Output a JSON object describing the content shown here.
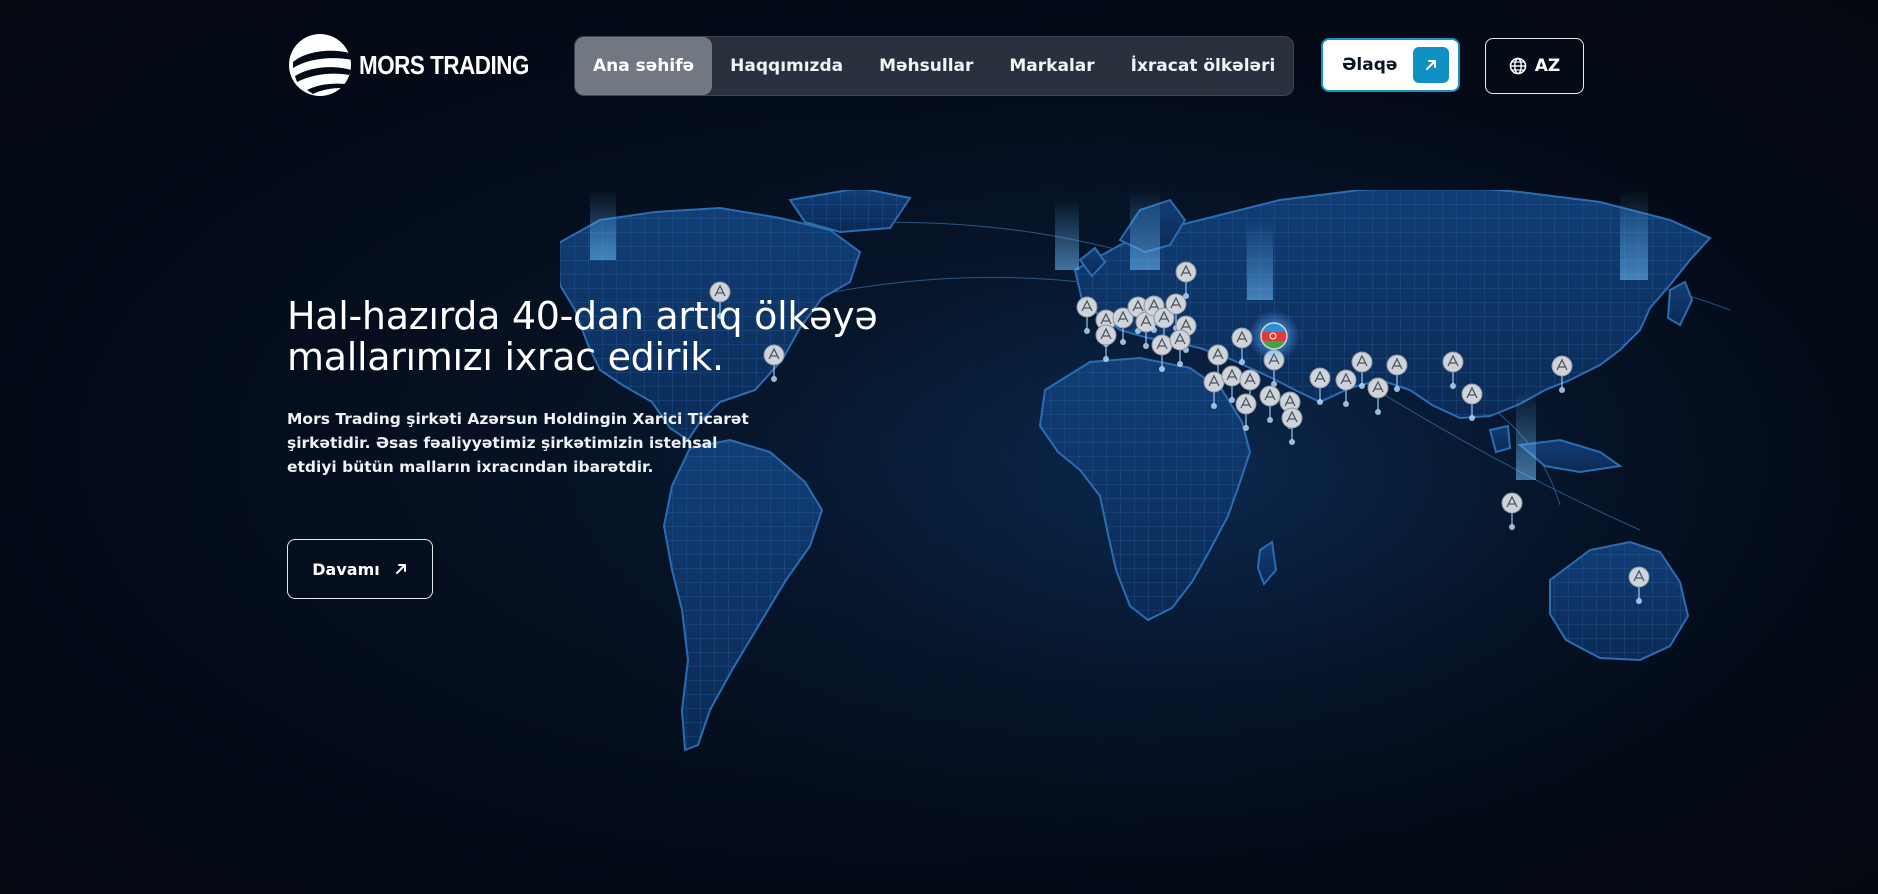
{
  "header": {
    "logo_text": "MORS TRADING",
    "nav": [
      {
        "label": "Ana səhifə",
        "active": true
      },
      {
        "label": "Haqqımızda",
        "active": false
      },
      {
        "label": "Məhsullar",
        "active": false
      },
      {
        "label": "Markalar",
        "active": false
      },
      {
        "label": "İxracat ölkələri",
        "active": false
      }
    ],
    "contact_label": "Əlaqə",
    "contact_icon": "arrow-up-right-icon",
    "language_label": "AZ",
    "language_icon": "globe-icon"
  },
  "hero": {
    "title": "Hal-hazırda 40-dan artıq ölkəyə mallarımızı ixrac edirik.",
    "description": "Mors Trading şirkəti Azərsun Holdingin Xarici Ticarət şirkətidir. Əsas fəaliyyətimiz şirkətimizin istehsal etdiyi bütün malların ixracından ibarətdir.",
    "button_label": "Davamı",
    "button_icon": "arrow-up-right-icon"
  },
  "map": {
    "icon": "world-map",
    "marker_icon": "location-pin-icon",
    "highlight_flag": "azerbaijan-flag-icon"
  },
  "colors": {
    "background": "#040a16",
    "accent": "#1190c4",
    "map_land": "#0e3566",
    "map_edge": "#2b6db3"
  }
}
